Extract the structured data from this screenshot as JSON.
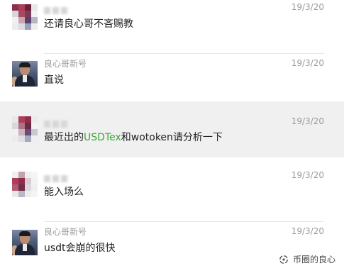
{
  "messages": [
    {
      "name": "",
      "time": "19/3/20",
      "text": "还请良心哥不吝赐教",
      "avatar": "pixelated"
    },
    {
      "name": "良心哥新号",
      "time": "19/3/20",
      "text": "直说",
      "avatar": "photo"
    },
    {
      "name": "",
      "time": "19/3/20",
      "text_before": "最近出的",
      "text_highlight": "USDTex",
      "text_after": "和wotoken请分析一下",
      "avatar": "pixelated"
    },
    {
      "name": "",
      "time": "19/3/20",
      "text": "能入场么",
      "avatar": "pixelated"
    },
    {
      "name": "良心哥新号",
      "time": "19/3/20",
      "text": "usdt会崩的很快",
      "avatar": "photo"
    }
  ],
  "watermark": {
    "text": "币圈的良心",
    "icon": "wechat-channel-icon"
  },
  "colors": {
    "highlight_text": "#3aa63a",
    "highlight_row": "#f0f0f0"
  }
}
